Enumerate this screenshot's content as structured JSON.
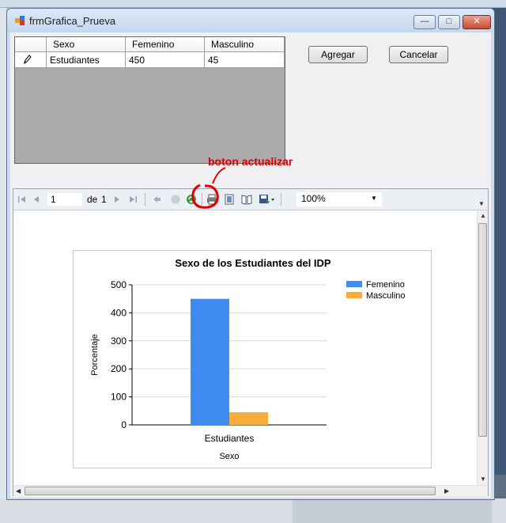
{
  "window": {
    "title": "frmGrafica_Prueva"
  },
  "grid": {
    "columns": [
      "Sexo",
      "Femenino",
      "Masculino"
    ],
    "rows": [
      {
        "sexo": "Estudiantes",
        "femenino": "450",
        "masculino": "45"
      }
    ]
  },
  "buttons": {
    "add": "Agregar",
    "cancel": "Cancelar"
  },
  "annotation": {
    "text": "boton actualizar",
    "color": "#e00000"
  },
  "toolbar": {
    "page": "1",
    "of_label": "de",
    "total_pages": "1",
    "zoom": "100%"
  },
  "colors": {
    "femenino": "#3e8cf0",
    "masculino": "#f7ac3c",
    "accent_red": "#e00000"
  },
  "chart_data": {
    "type": "bar",
    "title": "Sexo de los Estudiantes del IDP",
    "categories": [
      "Estudiantes"
    ],
    "series": [
      {
        "name": "Femenino",
        "values": [
          450
        ],
        "color": "#3e8cf0"
      },
      {
        "name": "Masculino",
        "values": [
          45
        ],
        "color": "#f7ac3c"
      }
    ],
    "xlabel": "Sexo",
    "ylabel": "Porcentaje",
    "ylim": [
      0,
      500
    ],
    "yticks": [
      0,
      100,
      200,
      300,
      400,
      500
    ],
    "grid": true,
    "legend": "top-right"
  }
}
